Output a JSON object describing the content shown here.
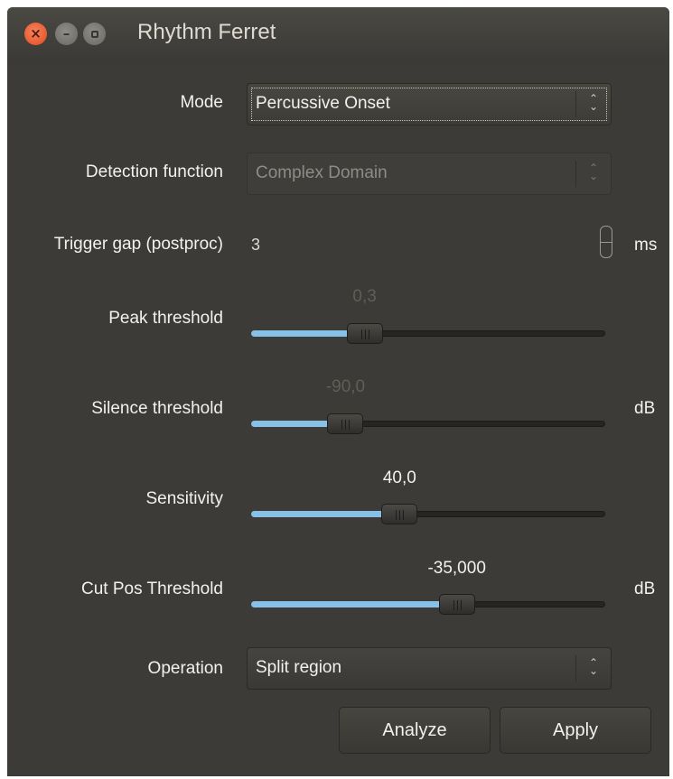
{
  "window": {
    "title": "Rhythm Ferret"
  },
  "form": {
    "mode": {
      "label": "Mode",
      "value": "Percussive Onset"
    },
    "detection": {
      "label": "Detection function",
      "value": "Complex Domain"
    },
    "trigger_gap": {
      "label": "Trigger gap (postproc)",
      "value": "3",
      "unit": "ms"
    },
    "peak_threshold": {
      "label": "Peak threshold",
      "value_text": "0,3",
      "level": 0.3
    },
    "silence_threshold": {
      "label": "Silence threshold",
      "value_text": "-90,0",
      "unit": "dB",
      "level": 0.24
    },
    "sensitivity": {
      "label": "Sensitivity",
      "value_text": "40,0",
      "level": 0.41
    },
    "cut_pos_threshold": {
      "label": "Cut Pos Threshold",
      "value_text": "-35,000",
      "unit": "dB",
      "level": 0.59
    },
    "operation": {
      "label": "Operation",
      "value": "Split region"
    }
  },
  "buttons": {
    "analyze": "Analyze",
    "apply": "Apply"
  },
  "colors": {
    "accent": "#88c1e7",
    "window_bg": "#3c3b37",
    "close_button": "#e2491f"
  }
}
